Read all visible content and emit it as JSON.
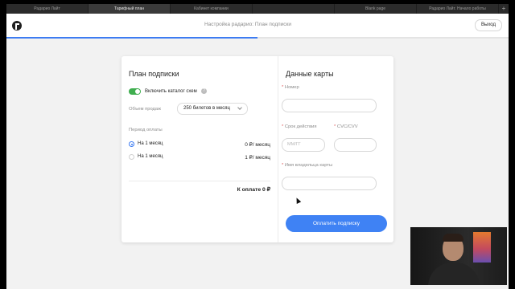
{
  "browser": {
    "tabs": [
      {
        "label": "Радарио Лайт",
        "active": false
      },
      {
        "label": "Тарифный план",
        "active": true
      },
      {
        "label": "Кабинет компании",
        "active": false
      },
      {
        "label": "",
        "active": false
      },
      {
        "label": "Blank page",
        "active": false
      },
      {
        "label": "Радарио Лайт. Начало работы",
        "active": false
      }
    ],
    "new_tab_label": "+"
  },
  "header": {
    "title": "Настройка радарио: План подписки",
    "exit_label": "Выход",
    "progress_fraction": 0.5
  },
  "plan": {
    "title": "План подписки",
    "catalog_toggle_label": "Включить каталог схем",
    "catalog_toggle_on": true,
    "help_icon": "?",
    "sales_volume_label": "Объем продаж",
    "sales_volume_value": "250 билетов в месяц",
    "period_label": "Период оплаты",
    "options": [
      {
        "label": "На 1 месяц",
        "price": "0 ₽/ месяц",
        "selected": true
      },
      {
        "label": "На 1 месяц",
        "price": "1 ₽/ месяц",
        "selected": false
      }
    ],
    "total": "К оплате 0 ₽"
  },
  "card": {
    "title": "Данные карты",
    "number_label": "Номер",
    "expiry_label": "Срок действия",
    "expiry_placeholder": "ММ/ГГ",
    "cvc_label": "CVC/CVV",
    "holder_label": "Имя владельца карты",
    "required_mark": "*",
    "pay_button": "Оплатить подписку"
  },
  "colors": {
    "accent": "#3f82f4",
    "toggle_on": "#3fae4f"
  }
}
